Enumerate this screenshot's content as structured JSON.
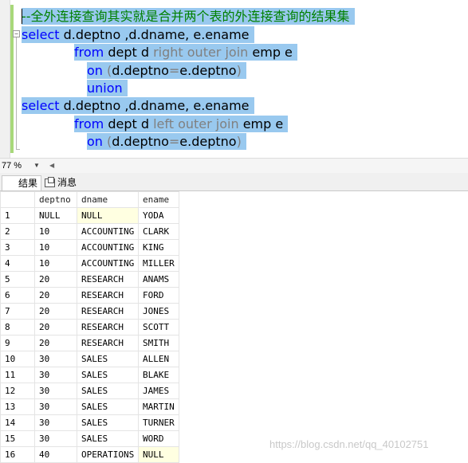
{
  "editor": {
    "lines": [
      {
        "parts": [
          {
            "t": "--全外连接查询其实就是合并两个表的外连接查询的结果集",
            "c": "cmt"
          }
        ]
      },
      {
        "parts": [
          {
            "t": "select",
            "c": "kw"
          },
          {
            "t": " d.deptno ,d.dname, e.ename",
            "c": "ident"
          }
        ]
      },
      {
        "parts": [
          {
            "t": "from",
            "c": "kw"
          },
          {
            "t": " dept d ",
            "c": "ident"
          },
          {
            "t": "right outer join",
            "c": "gray"
          },
          {
            "t": " emp e",
            "c": "ident"
          }
        ]
      },
      {
        "parts": [
          {
            "t": "on",
            "c": "kw"
          },
          {
            "t": " (",
            "c": "gray"
          },
          {
            "t": "d.deptno",
            "c": "ident"
          },
          {
            "t": "=",
            "c": "gray"
          },
          {
            "t": "e.deptno",
            "c": "ident"
          },
          {
            "t": ")",
            "c": "gray"
          }
        ]
      },
      {
        "parts": [
          {
            "t": "union",
            "c": "kw"
          }
        ]
      },
      {
        "parts": [
          {
            "t": "select",
            "c": "kw"
          },
          {
            "t": " d.deptno ,d.dname, e.ename",
            "c": "ident"
          }
        ]
      },
      {
        "parts": [
          {
            "t": "from",
            "c": "kw"
          },
          {
            "t": " dept d ",
            "c": "ident"
          },
          {
            "t": "left outer join",
            "c": "gray"
          },
          {
            "t": " emp e",
            "c": "ident"
          }
        ]
      },
      {
        "parts": [
          {
            "t": "on",
            "c": "kw"
          },
          {
            "t": " (",
            "c": "gray"
          },
          {
            "t": "d.deptno",
            "c": "ident"
          },
          {
            "t": "=",
            "c": "gray"
          },
          {
            "t": "e.deptno",
            "c": "ident"
          },
          {
            "t": ")",
            "c": "gray"
          }
        ]
      }
    ]
  },
  "status": {
    "zoom": "77 %",
    "zoom_arrow": "▼",
    "scroll_left": "◀"
  },
  "tabs": {
    "results": "结果",
    "messages": "消息"
  },
  "grid": {
    "columns": [
      "deptno",
      "dname",
      "ename"
    ],
    "rows": [
      [
        "1",
        "NULL",
        "NULL",
        "YODA"
      ],
      [
        "2",
        "10",
        "ACCOUNTING",
        "CLARK"
      ],
      [
        "3",
        "10",
        "ACCOUNTING",
        "KING"
      ],
      [
        "4",
        "10",
        "ACCOUNTING",
        "MILLER"
      ],
      [
        "5",
        "20",
        "RESEARCH",
        "ANAMS"
      ],
      [
        "6",
        "20",
        "RESEARCH",
        "FORD"
      ],
      [
        "7",
        "20",
        "RESEARCH",
        "JONES"
      ],
      [
        "8",
        "20",
        "RESEARCH",
        "SCOTT"
      ],
      [
        "9",
        "20",
        "RESEARCH",
        "SMITH"
      ],
      [
        "10",
        "30",
        "SALES",
        "ALLEN"
      ],
      [
        "11",
        "30",
        "SALES",
        "BLAKE"
      ],
      [
        "12",
        "30",
        "SALES",
        "JAMES"
      ],
      [
        "13",
        "30",
        "SALES",
        "MARTIN"
      ],
      [
        "14",
        "30",
        "SALES",
        "TURNER"
      ],
      [
        "15",
        "30",
        "SALES",
        "WORD"
      ],
      [
        "16",
        "40",
        "OPERATIONS",
        "NULL"
      ]
    ]
  },
  "watermark": "https://blog.csdn.net/qq_40102751"
}
